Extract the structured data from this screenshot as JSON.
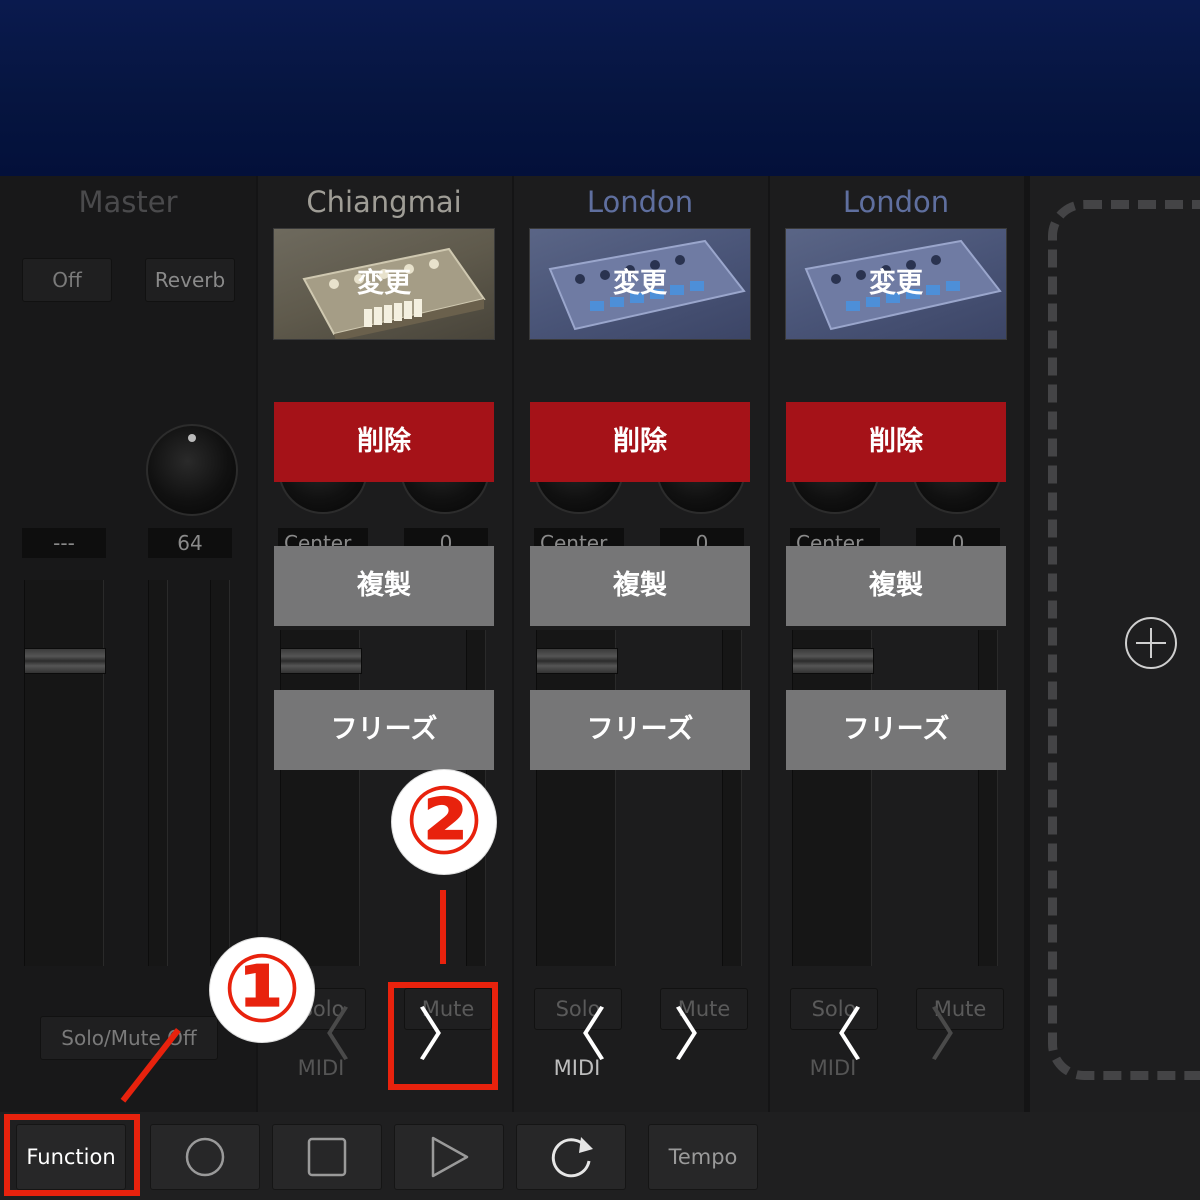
{
  "master": {
    "title": "Master",
    "off_label": "Off",
    "reverb_label": "Reverb",
    "readout_left": "---",
    "readout_right": "64",
    "solo_mute_off_label": "Solo/Mute Off"
  },
  "channels": [
    {
      "title": "Chiangmai",
      "change_label": "変更",
      "delete_label": "削除",
      "duplicate_label": "複製",
      "freeze_label": "フリーズ",
      "pan_label": "Center",
      "pan_value": "0",
      "solo_label": "Solo",
      "mute_label": "Mute",
      "midi_label": "MIDI"
    },
    {
      "title": "London",
      "change_label": "変更",
      "delete_label": "削除",
      "duplicate_label": "複製",
      "freeze_label": "フリーズ",
      "pan_label": "Center",
      "pan_value": "0",
      "solo_label": "Solo",
      "mute_label": "Mute",
      "midi_label": "MIDI"
    },
    {
      "title": "London",
      "change_label": "変更",
      "delete_label": "削除",
      "duplicate_label": "複製",
      "freeze_label": "フリーズ",
      "pan_label": "Center",
      "pan_value": "0",
      "solo_label": "Solo",
      "mute_label": "Mute",
      "midi_label": "MIDI"
    }
  ],
  "nav": {
    "prev_glyph": "〈",
    "next_glyph": "〉"
  },
  "toolbar": {
    "function_label": "Function",
    "tempo_label": "Tempo"
  },
  "callouts": {
    "one": "①",
    "two": "②"
  },
  "colors": {
    "accent_red": "#e8220d",
    "delete_red": "#a51218",
    "overlay_gray": "#767677"
  },
  "icons": [
    "record-icon",
    "stop-icon",
    "play-icon",
    "loop-icon",
    "add-track-plus-icon",
    "chevron-left-icon",
    "chevron-right-icon"
  ]
}
